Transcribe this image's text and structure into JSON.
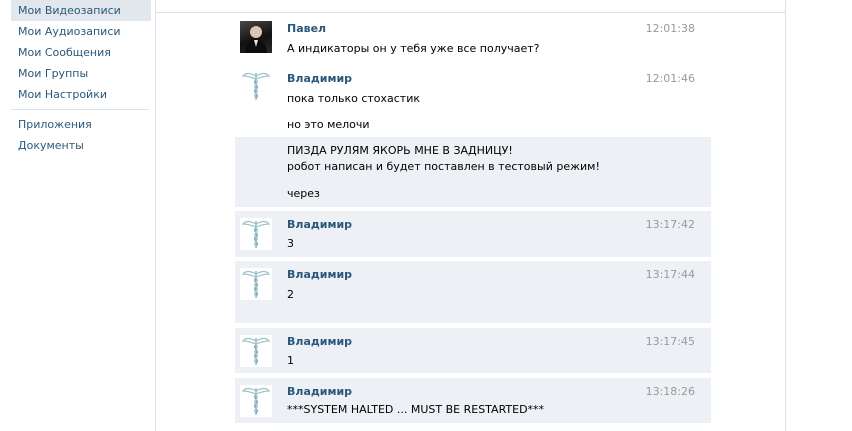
{
  "sidebar": {
    "items": [
      {
        "label": "Мои Видеозаписи"
      },
      {
        "label": "Мои Аудиозаписи"
      },
      {
        "label": "Мои Сообщения"
      },
      {
        "label": "Мои Группы"
      },
      {
        "label": "Мои Настройки"
      }
    ],
    "extra": [
      {
        "label": "Приложения"
      },
      {
        "label": "Документы"
      }
    ]
  },
  "messages": [
    {
      "author": "Павел",
      "time": "12:01:38",
      "lines": [
        "А индикаторы он у тебя уже все получает?"
      ]
    },
    {
      "author": "Владимир",
      "time": "12:01:46",
      "lines": [
        "пока только стохастик",
        "но это мелочи"
      ]
    },
    {
      "lines": [
        "ПИЗДА РУЛЯМ ЯКОРЬ МНЕ В ЗАДНИЦУ!",
        "робот написан и будет поставлен в тестовый режим!",
        "через"
      ]
    },
    {
      "author": "Владимир",
      "time": "13:17:42",
      "lines": [
        "3"
      ]
    },
    {
      "author": "Владимир",
      "time": "13:17:44",
      "lines": [
        "2"
      ]
    },
    {
      "author": "Владимир",
      "time": "13:17:45",
      "lines": [
        "1"
      ]
    },
    {
      "author": "Владимир",
      "time": "13:18:26",
      "lines": [
        "***SYSTEM HALTED ... MUST BE RESTARTED***"
      ]
    }
  ],
  "colors": {
    "link": "#2b587a",
    "unread_bg": "#edf1f5",
    "active_nav_bg": "#e1e7ed",
    "time": "#999999"
  },
  "icons": {
    "pavel_avatar": "user-photo",
    "vladimir_avatar": "caduceus-icon"
  }
}
